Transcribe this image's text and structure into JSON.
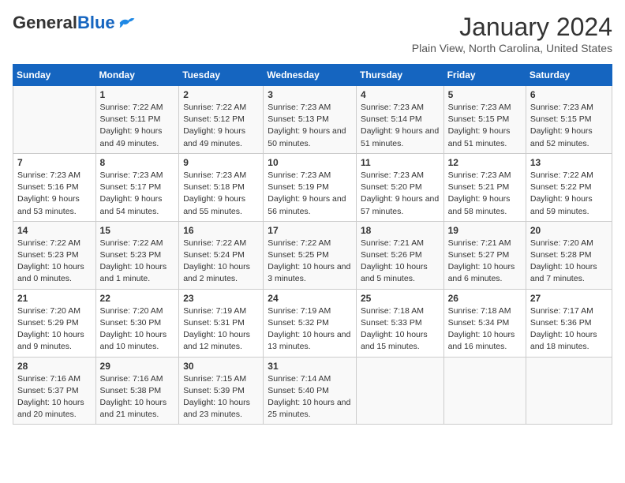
{
  "header": {
    "logo_general": "General",
    "logo_blue": "Blue",
    "month_title": "January 2024",
    "subtitle": "Plain View, North Carolina, United States"
  },
  "weekdays": [
    "Sunday",
    "Monday",
    "Tuesday",
    "Wednesday",
    "Thursday",
    "Friday",
    "Saturday"
  ],
  "weeks": [
    [
      {
        "day": "",
        "sunrise": "",
        "sunset": "",
        "daylight": ""
      },
      {
        "day": "1",
        "sunrise": "Sunrise: 7:22 AM",
        "sunset": "Sunset: 5:11 PM",
        "daylight": "Daylight: 9 hours and 49 minutes."
      },
      {
        "day": "2",
        "sunrise": "Sunrise: 7:22 AM",
        "sunset": "Sunset: 5:12 PM",
        "daylight": "Daylight: 9 hours and 49 minutes."
      },
      {
        "day": "3",
        "sunrise": "Sunrise: 7:23 AM",
        "sunset": "Sunset: 5:13 PM",
        "daylight": "Daylight: 9 hours and 50 minutes."
      },
      {
        "day": "4",
        "sunrise": "Sunrise: 7:23 AM",
        "sunset": "Sunset: 5:14 PM",
        "daylight": "Daylight: 9 hours and 51 minutes."
      },
      {
        "day": "5",
        "sunrise": "Sunrise: 7:23 AM",
        "sunset": "Sunset: 5:15 PM",
        "daylight": "Daylight: 9 hours and 51 minutes."
      },
      {
        "day": "6",
        "sunrise": "Sunrise: 7:23 AM",
        "sunset": "Sunset: 5:15 PM",
        "daylight": "Daylight: 9 hours and 52 minutes."
      }
    ],
    [
      {
        "day": "7",
        "sunrise": "Sunrise: 7:23 AM",
        "sunset": "Sunset: 5:16 PM",
        "daylight": "Daylight: 9 hours and 53 minutes."
      },
      {
        "day": "8",
        "sunrise": "Sunrise: 7:23 AM",
        "sunset": "Sunset: 5:17 PM",
        "daylight": "Daylight: 9 hours and 54 minutes."
      },
      {
        "day": "9",
        "sunrise": "Sunrise: 7:23 AM",
        "sunset": "Sunset: 5:18 PM",
        "daylight": "Daylight: 9 hours and 55 minutes."
      },
      {
        "day": "10",
        "sunrise": "Sunrise: 7:23 AM",
        "sunset": "Sunset: 5:19 PM",
        "daylight": "Daylight: 9 hours and 56 minutes."
      },
      {
        "day": "11",
        "sunrise": "Sunrise: 7:23 AM",
        "sunset": "Sunset: 5:20 PM",
        "daylight": "Daylight: 9 hours and 57 minutes."
      },
      {
        "day": "12",
        "sunrise": "Sunrise: 7:23 AM",
        "sunset": "Sunset: 5:21 PM",
        "daylight": "Daylight: 9 hours and 58 minutes."
      },
      {
        "day": "13",
        "sunrise": "Sunrise: 7:22 AM",
        "sunset": "Sunset: 5:22 PM",
        "daylight": "Daylight: 9 hours and 59 minutes."
      }
    ],
    [
      {
        "day": "14",
        "sunrise": "Sunrise: 7:22 AM",
        "sunset": "Sunset: 5:23 PM",
        "daylight": "Daylight: 10 hours and 0 minutes."
      },
      {
        "day": "15",
        "sunrise": "Sunrise: 7:22 AM",
        "sunset": "Sunset: 5:23 PM",
        "daylight": "Daylight: 10 hours and 1 minute."
      },
      {
        "day": "16",
        "sunrise": "Sunrise: 7:22 AM",
        "sunset": "Sunset: 5:24 PM",
        "daylight": "Daylight: 10 hours and 2 minutes."
      },
      {
        "day": "17",
        "sunrise": "Sunrise: 7:22 AM",
        "sunset": "Sunset: 5:25 PM",
        "daylight": "Daylight: 10 hours and 3 minutes."
      },
      {
        "day": "18",
        "sunrise": "Sunrise: 7:21 AM",
        "sunset": "Sunset: 5:26 PM",
        "daylight": "Daylight: 10 hours and 5 minutes."
      },
      {
        "day": "19",
        "sunrise": "Sunrise: 7:21 AM",
        "sunset": "Sunset: 5:27 PM",
        "daylight": "Daylight: 10 hours and 6 minutes."
      },
      {
        "day": "20",
        "sunrise": "Sunrise: 7:20 AM",
        "sunset": "Sunset: 5:28 PM",
        "daylight": "Daylight: 10 hours and 7 minutes."
      }
    ],
    [
      {
        "day": "21",
        "sunrise": "Sunrise: 7:20 AM",
        "sunset": "Sunset: 5:29 PM",
        "daylight": "Daylight: 10 hours and 9 minutes."
      },
      {
        "day": "22",
        "sunrise": "Sunrise: 7:20 AM",
        "sunset": "Sunset: 5:30 PM",
        "daylight": "Daylight: 10 hours and 10 minutes."
      },
      {
        "day": "23",
        "sunrise": "Sunrise: 7:19 AM",
        "sunset": "Sunset: 5:31 PM",
        "daylight": "Daylight: 10 hours and 12 minutes."
      },
      {
        "day": "24",
        "sunrise": "Sunrise: 7:19 AM",
        "sunset": "Sunset: 5:32 PM",
        "daylight": "Daylight: 10 hours and 13 minutes."
      },
      {
        "day": "25",
        "sunrise": "Sunrise: 7:18 AM",
        "sunset": "Sunset: 5:33 PM",
        "daylight": "Daylight: 10 hours and 15 minutes."
      },
      {
        "day": "26",
        "sunrise": "Sunrise: 7:18 AM",
        "sunset": "Sunset: 5:34 PM",
        "daylight": "Daylight: 10 hours and 16 minutes."
      },
      {
        "day": "27",
        "sunrise": "Sunrise: 7:17 AM",
        "sunset": "Sunset: 5:36 PM",
        "daylight": "Daylight: 10 hours and 18 minutes."
      }
    ],
    [
      {
        "day": "28",
        "sunrise": "Sunrise: 7:16 AM",
        "sunset": "Sunset: 5:37 PM",
        "daylight": "Daylight: 10 hours and 20 minutes."
      },
      {
        "day": "29",
        "sunrise": "Sunrise: 7:16 AM",
        "sunset": "Sunset: 5:38 PM",
        "daylight": "Daylight: 10 hours and 21 minutes."
      },
      {
        "day": "30",
        "sunrise": "Sunrise: 7:15 AM",
        "sunset": "Sunset: 5:39 PM",
        "daylight": "Daylight: 10 hours and 23 minutes."
      },
      {
        "day": "31",
        "sunrise": "Sunrise: 7:14 AM",
        "sunset": "Sunset: 5:40 PM",
        "daylight": "Daylight: 10 hours and 25 minutes."
      },
      {
        "day": "",
        "sunrise": "",
        "sunset": "",
        "daylight": ""
      },
      {
        "day": "",
        "sunrise": "",
        "sunset": "",
        "daylight": ""
      },
      {
        "day": "",
        "sunrise": "",
        "sunset": "",
        "daylight": ""
      }
    ]
  ]
}
